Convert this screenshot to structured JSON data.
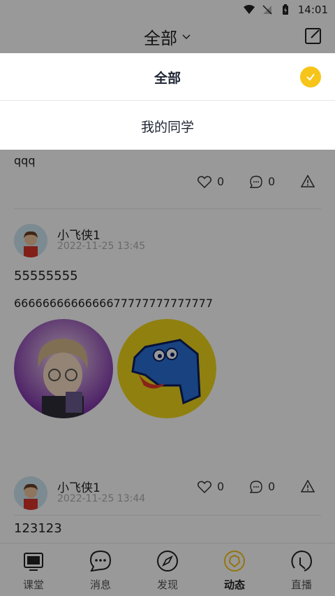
{
  "status_bar": {
    "time": "14:01"
  },
  "header": {
    "title": "全部"
  },
  "dropdown": {
    "options": [
      {
        "label": "全部",
        "selected": true
      },
      {
        "label": "我的同学",
        "selected": false
      }
    ]
  },
  "feed": {
    "partial_post": {
      "text": "qqq",
      "likes": "0",
      "comments": "0"
    },
    "posts": [
      {
        "author": "小飞侠1",
        "time": "2022-11-25 13:45",
        "title": "55555555",
        "body": "6666666666666677777777777777",
        "likes": "0",
        "comments": "0"
      },
      {
        "author": "小飞侠1",
        "time": "2022-11-25 13:44",
        "title": "123123"
      }
    ]
  },
  "bottom_nav": [
    {
      "label": "课堂",
      "icon": "tv-icon"
    },
    {
      "label": "消息",
      "icon": "chat-bubble-icon"
    },
    {
      "label": "发现",
      "icon": "compass-icon"
    },
    {
      "label": "动态",
      "icon": "moments-icon",
      "active": true
    },
    {
      "label": "直播",
      "icon": "live-icon"
    }
  ],
  "colors": {
    "accent": "#f7c41a",
    "overlay": "rgba(0,0,0,0.4)"
  }
}
